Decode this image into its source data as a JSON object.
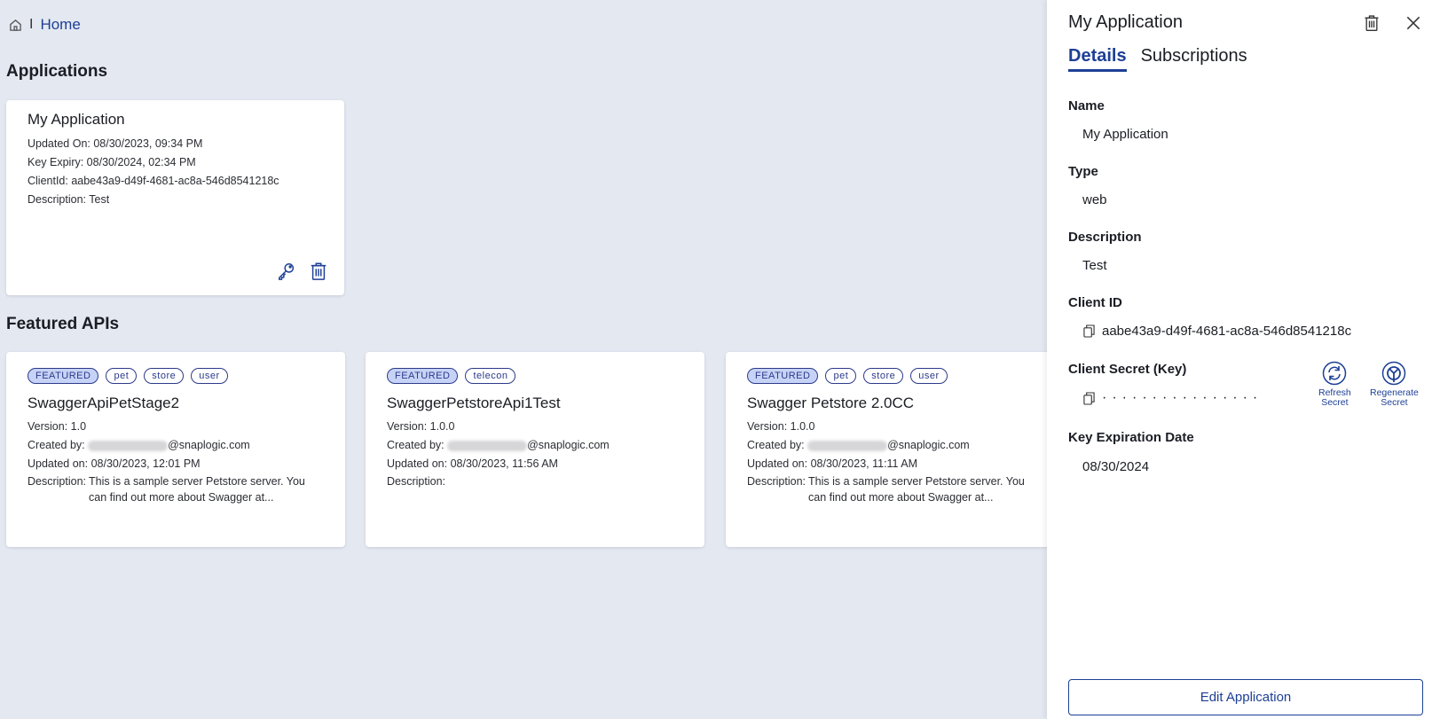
{
  "breadcrumb": {
    "separator": "I",
    "home": "Home"
  },
  "applications": {
    "title": "Applications",
    "card": {
      "name": "My Application",
      "updated_on": "Updated On: 08/30/2023, 09:34 PM",
      "key_expiry": "Key Expiry: 08/30/2024, 02:34 PM",
      "client_id": "ClientId: aabe43a9-d49f-4681-ac8a-546d8541218c",
      "description": "Description: Test"
    }
  },
  "featured": {
    "title": "Featured APIs",
    "cards": [
      {
        "tags": [
          "FEATURED",
          "pet",
          "store",
          "user"
        ],
        "name": "SwaggerApiPetStage2",
        "version": "Version: 1.0",
        "created_by_label": "Created by:",
        "created_by_domain": "@snaplogic.com",
        "updated_on": "Updated on: 08/30/2023, 12:01 PM",
        "description_label": "Description:",
        "description": "This is a sample server Petstore server. You can find out more about Swagger at..."
      },
      {
        "tags": [
          "FEATURED",
          "telecon"
        ],
        "name": "SwaggerPetstoreApi1Test",
        "version": "Version: 1.0.0",
        "created_by_label": "Created by:",
        "created_by_domain": "@snaplogic.com",
        "updated_on": "Updated on: 08/30/2023, 11:56 AM",
        "description_label": "Description:",
        "description": ""
      },
      {
        "tags": [
          "FEATURED",
          "pet",
          "store",
          "user"
        ],
        "name": "Swagger Petstore 2.0CC",
        "version": "Version: 1.0.0",
        "created_by_label": "Created by:",
        "created_by_domain": "@snaplogic.com",
        "updated_on": "Updated on: 08/30/2023, 11:11 AM",
        "description_label": "Description:",
        "description": "This is a sample server Petstore server. You can find out more about Swagger at..."
      }
    ]
  },
  "panel": {
    "title": "My Application",
    "tabs": [
      "Details",
      "Subscriptions"
    ],
    "name_label": "Name",
    "name_value": "My Application",
    "type_label": "Type",
    "type_value": "web",
    "desc_label": "Description",
    "desc_value": "Test",
    "client_id_label": "Client ID",
    "client_id_value": "aabe43a9-d49f-4681-ac8a-546d8541218c",
    "secret_label": "Client Secret (Key)",
    "secret_mask": "················",
    "refresh_label_1": "Refresh",
    "refresh_label_2": "Secret",
    "regen_label_1": "Regenerate",
    "regen_label_2": "Secret",
    "expiry_label": "Key Expiration Date",
    "expiry_value": "08/30/2024",
    "edit_button": "Edit Application"
  },
  "colors": {
    "accent": "#1d3f95",
    "background": "#e4e8f1",
    "tag_featured": "#c7d3f6"
  }
}
